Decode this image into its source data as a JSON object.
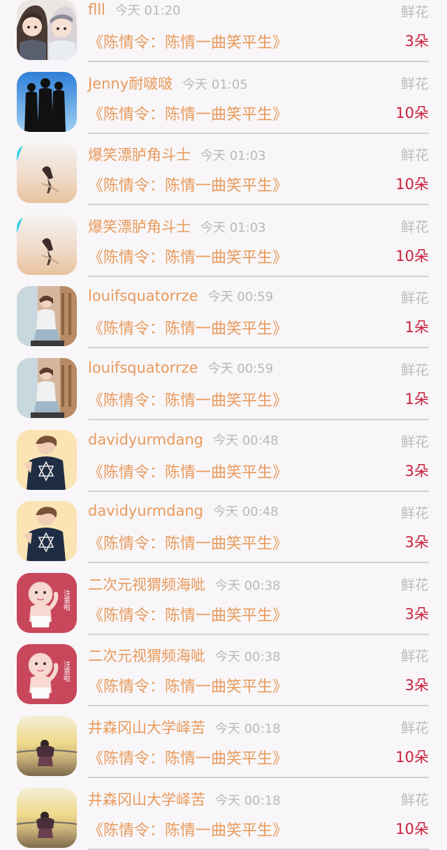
{
  "rows": [
    {
      "name": "flll",
      "time": "今天 01:20",
      "type": "鲜花",
      "work": "《陈情令：陈情一曲笑平生》",
      "count": "3朵",
      "avatar": "anime-couple-icon"
    },
    {
      "name": "Jenny耐啵啵",
      "time": "今天 01:05",
      "type": "鲜花",
      "work": "《陈情令：陈情一曲笑平生》",
      "count": "10朵",
      "avatar": "silhouettes-icon"
    },
    {
      "name": "爆笑漂胪角斗士",
      "time": "今天 01:03",
      "type": "鲜花",
      "work": "《陈情令：陈情一曲笑平生》",
      "count": "10朵",
      "avatar": "beach-figure-icon"
    },
    {
      "name": "爆笑漂胪角斗士",
      "time": "今天 01:03",
      "type": "鲜花",
      "work": "《陈情令：陈情一曲笑平生》",
      "count": "10朵",
      "avatar": "beach-figure-icon"
    },
    {
      "name": "louifsquatorrze",
      "time": "今天 00:59",
      "type": "鲜花",
      "work": "《陈情令：陈情一曲笑平生》",
      "count": "1朵",
      "avatar": "sitting-girl-icon"
    },
    {
      "name": "louifsquatorrze",
      "time": "今天 00:59",
      "type": "鲜花",
      "work": "《陈情令：陈情一曲笑平生》",
      "count": "1朵",
      "avatar": "sitting-girl-icon"
    },
    {
      "name": "davidyurmdang",
      "time": "今天 00:48",
      "type": "鲜花",
      "work": "《陈情令：陈情一曲笑平生》",
      "count": "3朵",
      "avatar": "boy-tshirt-icon"
    },
    {
      "name": "davidyurmdang",
      "time": "今天 00:48",
      "type": "鲜花",
      "work": "《陈情令：陈情一曲笑平生》",
      "count": "3朵",
      "avatar": "boy-tshirt-icon"
    },
    {
      "name": "二次元视猬频海呲",
      "time": "今天 00:38",
      "type": "鲜花",
      "work": "《陈情令：陈情一曲笑平生》",
      "count": "3朵",
      "avatar": "baby-sticker-icon"
    },
    {
      "name": "二次元视猬频海呲",
      "time": "今天 00:38",
      "type": "鲜花",
      "work": "《陈情令：陈情一曲笑平生》",
      "count": "3朵",
      "avatar": "baby-sticker-icon"
    },
    {
      "name": "井森冈山大学峄苦",
      "time": "今天 00:18",
      "type": "鲜花",
      "work": "《陈情令：陈情一曲笑平生》",
      "count": "10朵",
      "avatar": "sunset-sea-icon"
    },
    {
      "name": "井森冈山大学峄苦",
      "time": "今天 00:18",
      "type": "鲜花",
      "work": "《陈情令：陈情一曲笑平生》",
      "count": "10朵",
      "avatar": "sunset-sea-icon"
    }
  ],
  "baby_sticker_text": "注意啦"
}
